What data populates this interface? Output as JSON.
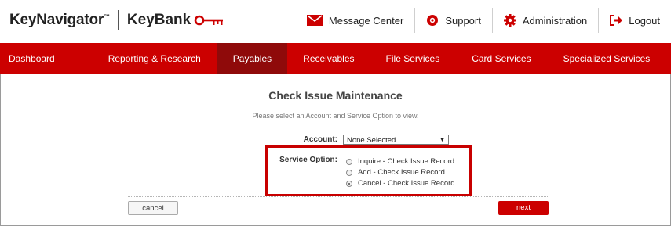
{
  "brand": {
    "product": "KeyNavigator",
    "product_tm": "™",
    "bank": "KeyBank"
  },
  "header_nav": [
    {
      "label": "Message Center",
      "icon": "envelope-icon"
    },
    {
      "label": "Support",
      "icon": "lifebuoy-icon"
    },
    {
      "label": "Administration",
      "icon": "gear-icon"
    },
    {
      "label": "Logout",
      "icon": "logout-icon"
    }
  ],
  "main_nav": [
    {
      "label": "Dashboard"
    },
    {
      "label": "Reporting & Research"
    },
    {
      "label": "Payables",
      "active": true
    },
    {
      "label": "Receivables"
    },
    {
      "label": "File Services"
    },
    {
      "label": "Card Services"
    },
    {
      "label": "Specialized Services"
    }
  ],
  "page": {
    "title": "Check Issue Maintenance",
    "subtitle": "Please select an Account and Service Option to view."
  },
  "form": {
    "account_label": "Account:",
    "account_value": "None Selected",
    "service_label": "Service Option:",
    "options": [
      {
        "label": "Inquire - Check Issue Record",
        "selected": false
      },
      {
        "label": "Add - Check Issue Record",
        "selected": false
      },
      {
        "label": "Cancel - Check Issue Record",
        "selected": true
      }
    ]
  },
  "buttons": {
    "cancel": "cancel",
    "next": "next"
  },
  "colors": {
    "brand_red": "#cc0000",
    "active_tab": "#8f0a0a",
    "highlight_box": "#c80000"
  }
}
